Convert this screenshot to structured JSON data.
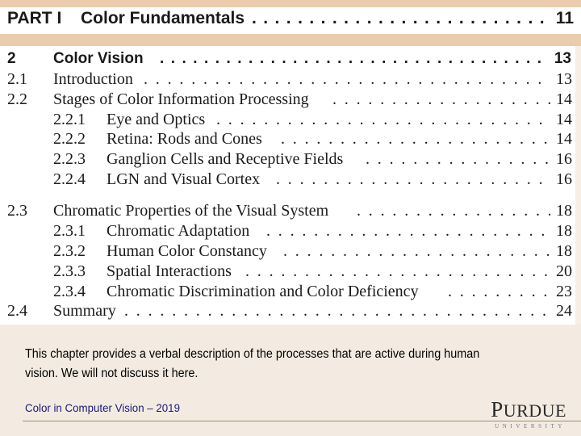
{
  "toc": {
    "part": {
      "label": "PART I",
      "title": "Color Fundamentals",
      "page": "11"
    },
    "chapter": {
      "number": "2",
      "title": "Color Vision",
      "page": "13"
    },
    "entries": [
      {
        "number": "2.1",
        "title": "Introduction",
        "page": "13",
        "level": 1
      },
      {
        "number": "2.2",
        "title": "Stages of Color Information Processing",
        "page": "14",
        "level": 1
      },
      {
        "number": "2.2.1",
        "title": "Eye and Optics",
        "page": "14",
        "level": 2
      },
      {
        "number": "2.2.2",
        "title": "Retina: Rods and Cones",
        "page": "14",
        "level": 2
      },
      {
        "number": "2.2.3",
        "title": "Ganglion Cells and Receptive Fields",
        "page": "16",
        "level": 2
      },
      {
        "number": "2.2.4",
        "title": "LGN and Visual Cortex",
        "page": "16",
        "level": 2
      },
      {
        "number": "2.3",
        "title": "Chromatic Properties of the Visual System",
        "page": "18",
        "level": 1
      },
      {
        "number": "2.3.1",
        "title": "Chromatic Adaptation",
        "page": "18",
        "level": 2
      },
      {
        "number": "2.3.2",
        "title": "Human Color Constancy",
        "page": "18",
        "level": 2
      },
      {
        "number": "2.3.3",
        "title": "Spatial Interactions",
        "page": "20",
        "level": 2
      },
      {
        "number": "2.3.4",
        "title": "Chromatic Discrimination and Color Deficiency",
        "page": "23",
        "level": 2
      },
      {
        "number": "2.4",
        "title": "Summary",
        "page": "24",
        "level": 1
      }
    ],
    "leader": ". . . . . . . . . . . . . . . . . . . . . . . . . . . . . . . . . . . . . . . . . . . . . . . . . . . . . . . . . . . . . . . . . . . . . . . . . . ."
  },
  "description": "This chapter provides a verbal description of the processes that are active during human vision. We will not discuss it here.",
  "footer": {
    "course": "Color in Computer Vision – 2019",
    "logo_initial": "P",
    "logo_rest": "URDUE",
    "logo_sub": "UNIVERSITY"
  },
  "colors": {
    "band": "#e9cdac",
    "background": "#f3ebe1",
    "footer_text": "#1a1a80",
    "footer_rule": "#a68c6a"
  }
}
